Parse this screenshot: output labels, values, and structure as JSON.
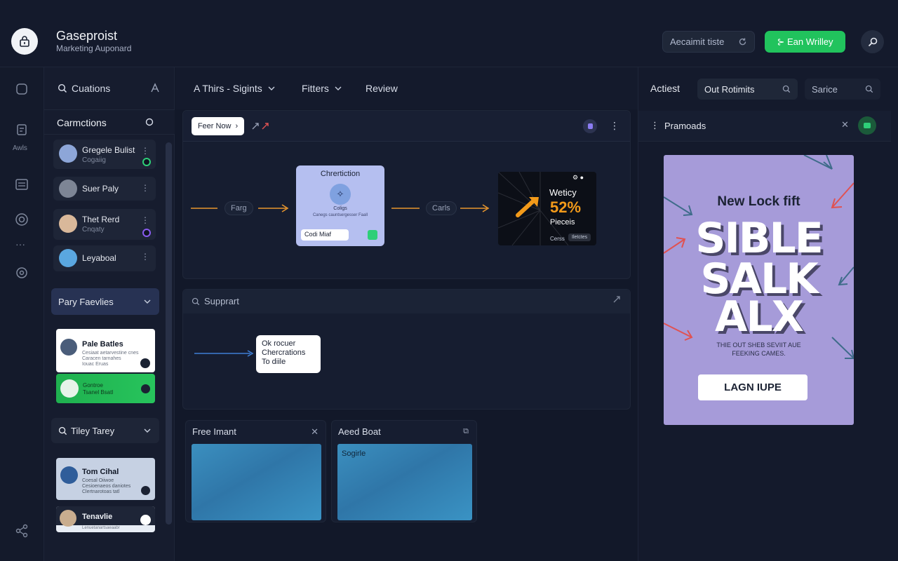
{
  "app": {
    "title": "Gaseproist",
    "subtitle": "Marketing Auponard"
  },
  "header": {
    "search_value": "Aecaimit tiste",
    "cta_label": "⊱ Ean Wrilley"
  },
  "rail": {
    "label": "Awls"
  },
  "contacts_panel": {
    "search_label": "Cuations",
    "section_title": "Carmctions",
    "contacts": [
      {
        "name": "Gregele Bulist",
        "sub": "Cogaiig"
      },
      {
        "name": "Suer Paly",
        "sub": ""
      },
      {
        "name": "Thet Rerd",
        "sub": "Cnqaty"
      },
      {
        "name": "Leyaboal",
        "sub": ""
      }
    ],
    "dropdown1": "Pary Faevlies",
    "card1": {
      "name": "Pale Batles",
      "lines": [
        "Cesiaat aetarvestine cnes",
        "Caracen tarnahes",
        "Iouac Eruas"
      ]
    },
    "card2": {
      "line1": "Gontroe",
      "line2": "Tsanel Bsatl"
    },
    "dropdown2": "Tiley Tarey",
    "card3": {
      "name": "Tom Cihal",
      "lines": [
        "Coesal Oiiwoe",
        "Cesioenaeos daniotes",
        "Clertnarotoas tatl"
      ]
    },
    "card4": {
      "name": "Tenavlie",
      "sub": "Lenuetanartsaeaabr"
    }
  },
  "toolbar": {
    "item1": "A Thirs - Sigints",
    "item2": "Fitters",
    "item3": "Review"
  },
  "flow": {
    "button": "Feer Now",
    "node1": "Farg",
    "card_title": "Chrertiction",
    "card_caption": "Coligs",
    "card_caption2": "Canegs cauntsergesser Faall",
    "card_input": "Codi Miaf",
    "node2": "Carls",
    "promo": {
      "line1": "Weticy",
      "percent": "52%",
      "line2": "Pieceis",
      "footer": "Cerss",
      "badge": "Iletctes"
    }
  },
  "support": {
    "title": "Supprart",
    "bubble": [
      "Ok rocuer",
      "Chercrations",
      "To diile"
    ]
  },
  "tiles": [
    {
      "title": "Free Imant"
    },
    {
      "title": "Aeed Boat",
      "caption": "Sogirle"
    }
  ],
  "right_panel": {
    "tab": "Actiest",
    "chip1": "Out Rotimits",
    "chip2": "Sarice",
    "bar_title": "Pramoads",
    "poster": {
      "headline": "New Lock fift",
      "words": [
        "SIBLE",
        "SALK",
        "ALX"
      ],
      "small": "THIE OUT SHEB SEVIIT AUE FEEKING CAMES.",
      "button": "LAGN IUPE"
    }
  },
  "colors": {
    "accent_green": "#21c35d",
    "background": "#121829",
    "lavender": "#a69bd9",
    "orange": "#e8962e"
  }
}
